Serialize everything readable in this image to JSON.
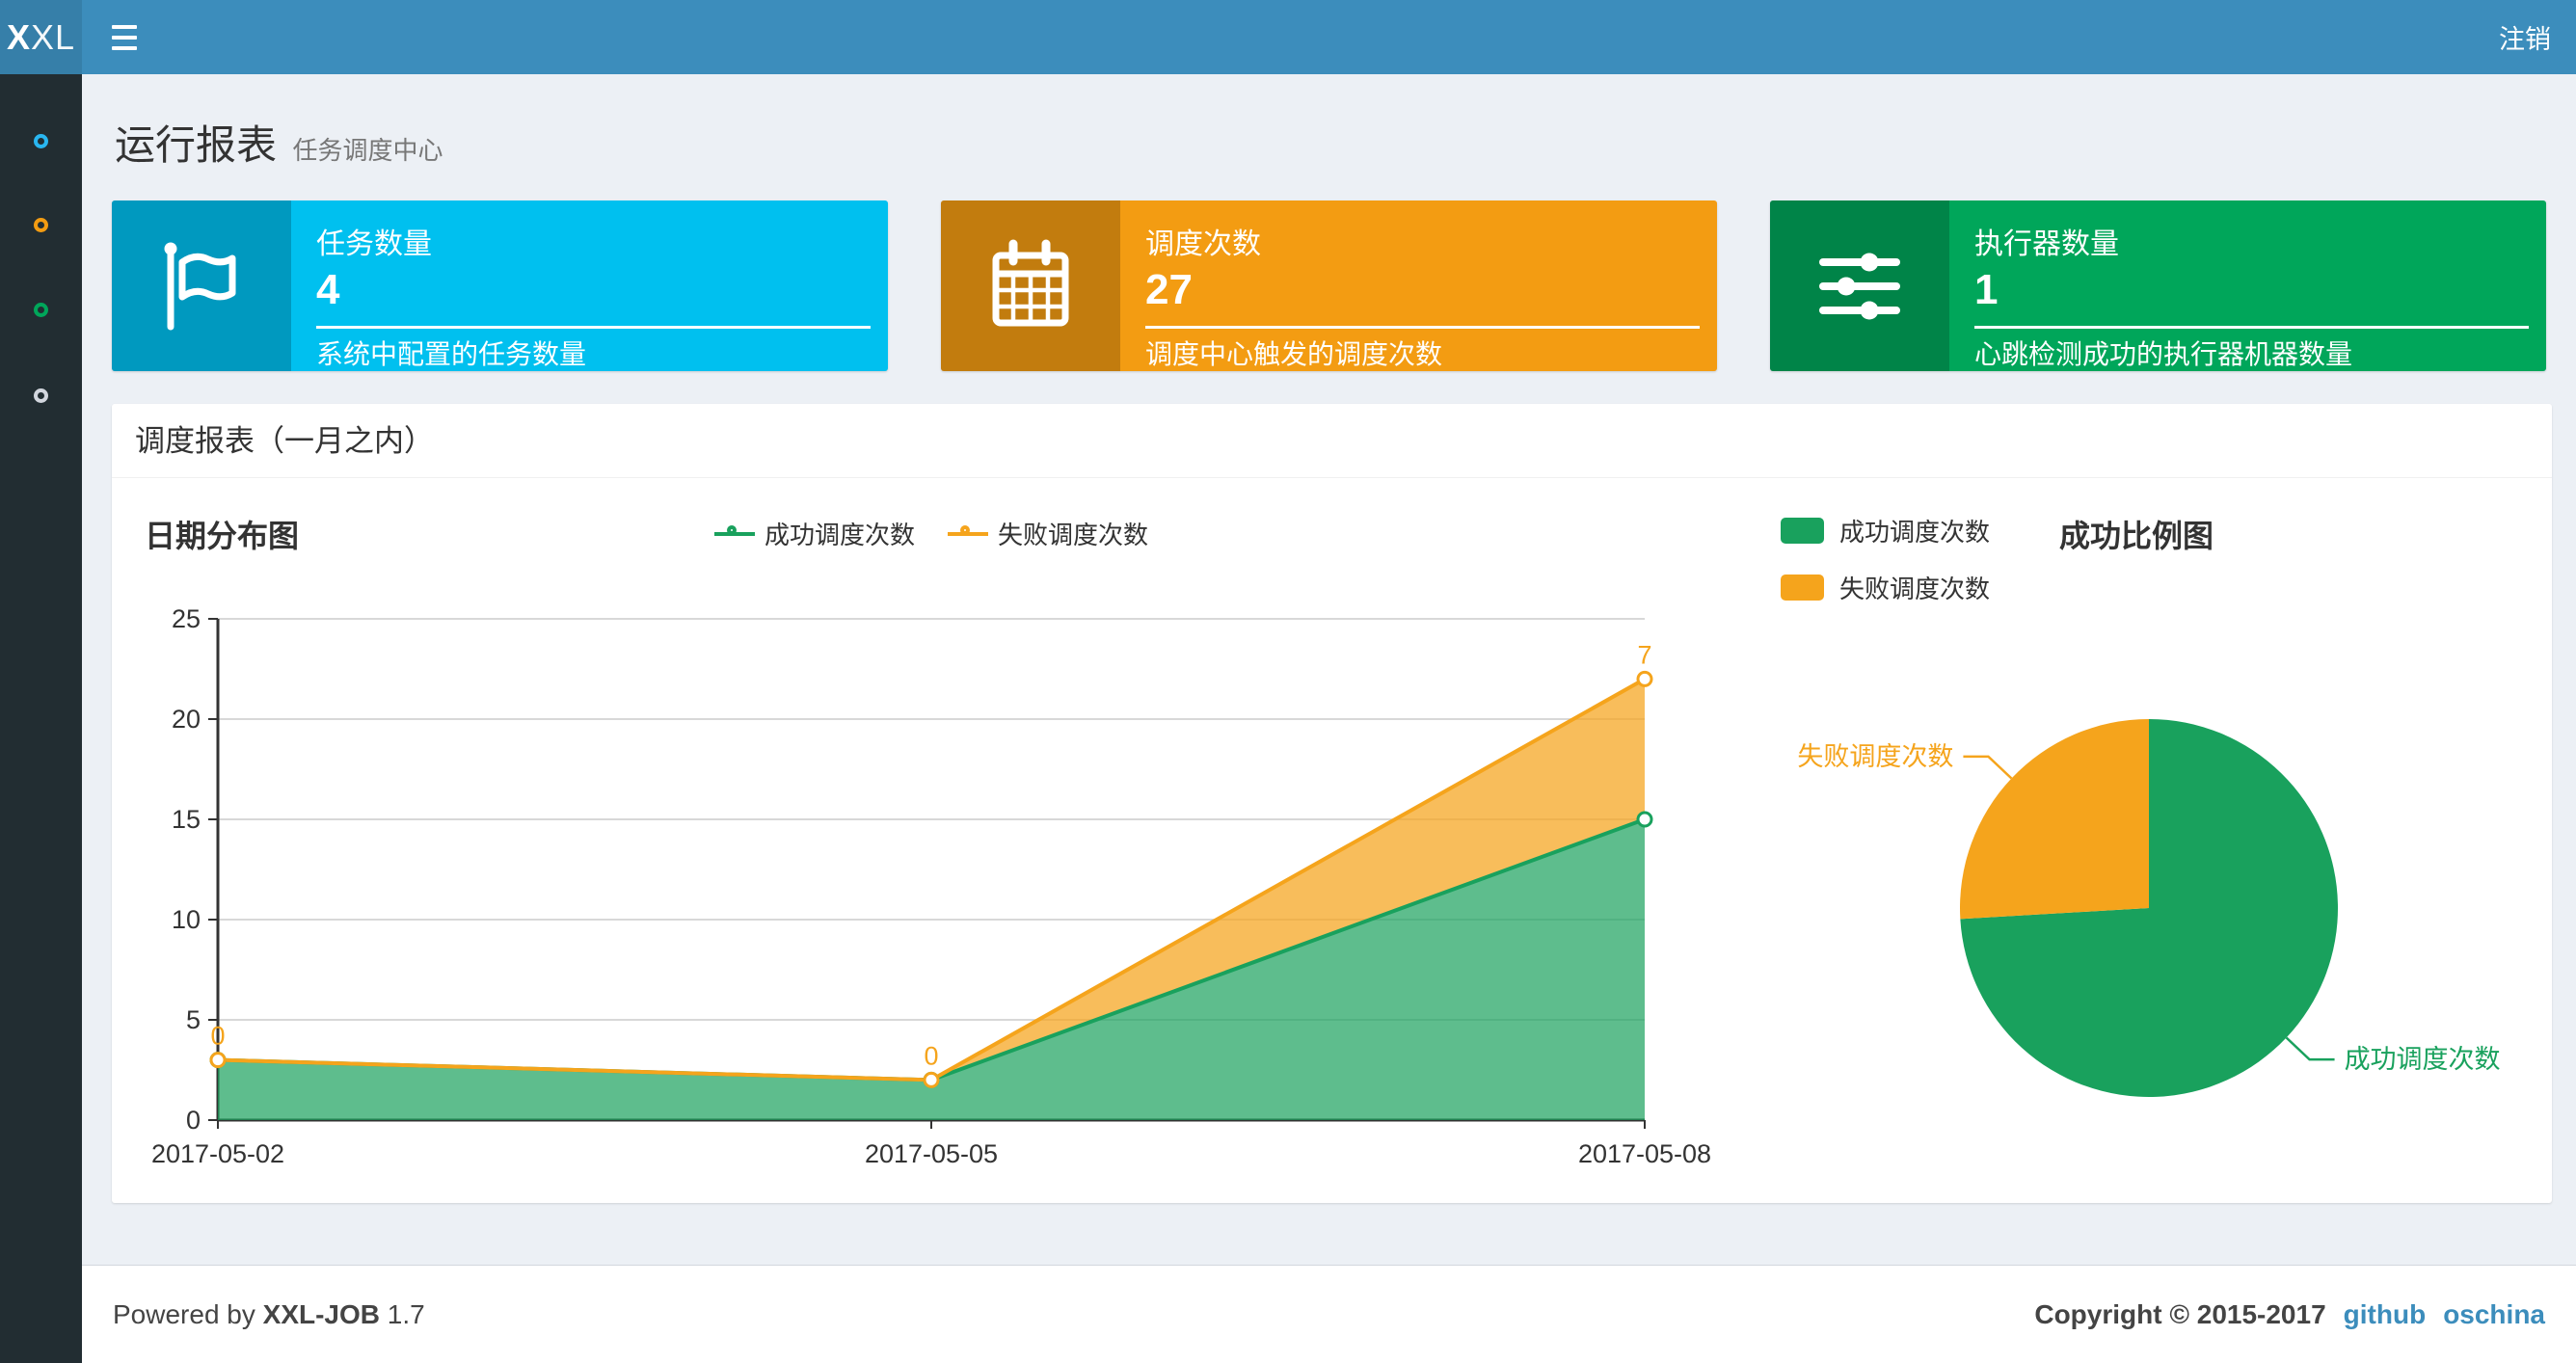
{
  "navbar": {
    "logo_bold": "X",
    "logo_rest": "XL",
    "logout_label": "注销",
    "bg": "#3c8dbc",
    "logo_bg": "#367fa9"
  },
  "sidebar": {
    "bg": "#222d32",
    "items": [
      {
        "icon": "circle-outline-icon",
        "color": "#29b6f0"
      },
      {
        "icon": "circle-outline-icon",
        "color": "#f39c12"
      },
      {
        "icon": "circle-outline-icon",
        "color": "#00a65a"
      },
      {
        "icon": "circle-outline-icon",
        "color": "#d2d6de"
      }
    ]
  },
  "page_header": {
    "title": "运行报表",
    "subtitle": "任务调度中心"
  },
  "info_boxes": [
    {
      "icon": "flag-icon",
      "label": "任务数量",
      "value": "4",
      "description": "系统中配置的任务数量",
      "color": "#00c0ef"
    },
    {
      "icon": "calendar-icon",
      "label": "调度次数",
      "value": "27",
      "description": "调度中心触发的调度次数",
      "color": "#f39c12"
    },
    {
      "icon": "sliders-icon",
      "label": "执行器数量",
      "value": "1",
      "description": "心跳检测成功的执行器机器数量",
      "color": "#00a65a"
    }
  ],
  "panel": {
    "title": "调度报表（一月之内）"
  },
  "chart_data": [
    {
      "type": "area",
      "title": "日期分布图",
      "x": [
        "2017-05-02",
        "2017-05-05",
        "2017-05-08"
      ],
      "series": [
        {
          "name": "成功调度次数",
          "values": [
            3,
            2,
            15
          ],
          "color": "#19a15d",
          "fill": "rgba(25,161,93,0.7)"
        },
        {
          "name": "失败调度次数",
          "values": [
            0,
            0,
            7
          ],
          "color": "#f5a41c",
          "fill": "rgba(245,164,28,0.72)",
          "point_labels": [
            "0",
            "0",
            "7"
          ]
        }
      ],
      "stacked": true,
      "ylim": [
        0,
        25
      ],
      "yticks": [
        0,
        5,
        10,
        15,
        20,
        25
      ],
      "grid": true,
      "legend_position": "top-center"
    },
    {
      "type": "pie",
      "title": "成功比例图",
      "slices": [
        {
          "name": "成功调度次数",
          "value": 20,
          "color": "#19a15d"
        },
        {
          "name": "失败调度次数",
          "value": 7,
          "color": "#f5a41c"
        }
      ],
      "legend_position": "top-left"
    }
  ],
  "footer": {
    "powered_prefix": "Powered by",
    "product": "XXL-JOB",
    "version": "1.7",
    "copyright": "Copyright © 2015-2017",
    "links": [
      {
        "label": "github"
      },
      {
        "label": "oschina"
      }
    ],
    "link_color": "#3c8dbc"
  }
}
